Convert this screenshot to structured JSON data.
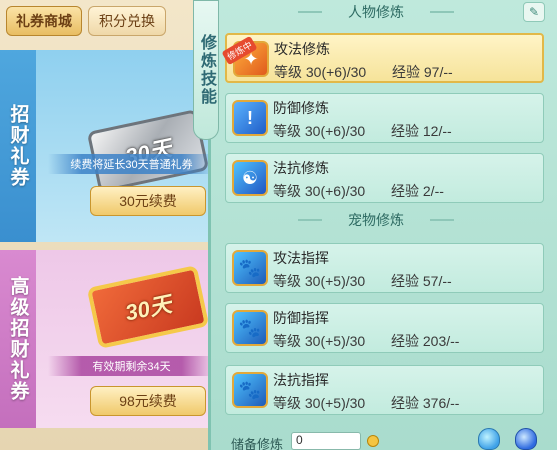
{
  "mall": {
    "tabs": [
      {
        "label": "礼券商城",
        "active": true
      },
      {
        "label": "积分兑换",
        "active": false
      }
    ],
    "cards": [
      {
        "side_label": "招财礼券",
        "ticket_text": "30天",
        "note": "续费将延长30天普通礼券",
        "button": "30元续费"
      },
      {
        "side_label": "高级招财礼券",
        "ticket_text": "30天",
        "note": "有效期剩余34天",
        "button": "98元续费"
      }
    ]
  },
  "panel": {
    "side_tab": "修炼技能",
    "character_section": "人物修炼",
    "pet_section": "宠物修炼",
    "level_label": "等级",
    "exp_label": "经验",
    "in_progress_badge": "修炼中",
    "rows": [
      {
        "name": "攻法修炼",
        "level": "30(+6)/30",
        "exp": "97/--",
        "selected": true,
        "icon": "attack-magic-icon"
      },
      {
        "name": "防御修炼",
        "level": "30(+6)/30",
        "exp": "12/--",
        "selected": false,
        "icon": "defense-shield-icon"
      },
      {
        "name": "法抗修炼",
        "level": "30(+6)/30",
        "exp": "2/--",
        "selected": false,
        "icon": "magic-resist-icon"
      },
      {
        "name": "攻法指挥",
        "level": "30(+5)/30",
        "exp": "57/--",
        "selected": false,
        "icon": "pet-attack-icon"
      },
      {
        "name": "防御指挥",
        "level": "30(+5)/30",
        "exp": "203/--",
        "selected": false,
        "icon": "pet-defense-icon"
      },
      {
        "name": "法抗指挥",
        "level": "30(+5)/30",
        "exp": "376/--",
        "selected": false,
        "icon": "pet-resist-icon"
      }
    ],
    "bottom": {
      "label": "储备修炼",
      "value": "0"
    }
  },
  "colors": {
    "panel_bg": "#bfe9dc",
    "selected_row": "#f6e39a",
    "accent_gold": "#e2b848"
  }
}
